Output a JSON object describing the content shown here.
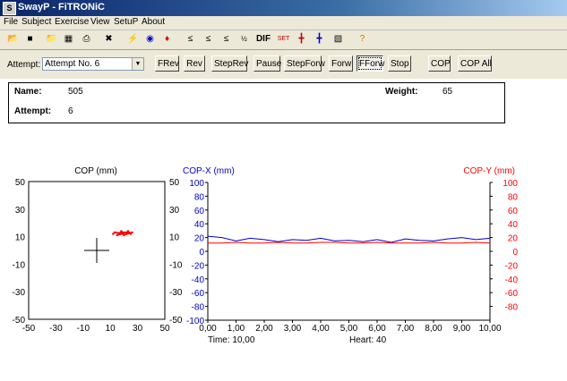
{
  "window": {
    "title": "SwayP - FiTRONiC",
    "icon": "app-icon"
  },
  "menu": [
    "File",
    "Subject",
    "Exercise",
    "View",
    "SetuP",
    "About"
  ],
  "toolbar": {
    "icons": [
      "open-folder-icon",
      "save-disk-icon",
      "open-file-icon",
      "report-icon",
      "print-icon",
      "tools-icon",
      "yellow-lightning-icon",
      "eye-icon",
      "red-flame-icon",
      "filter-1-icon",
      "filter-2-icon",
      "filter-h-icon",
      "sort-icon",
      "dif-icon",
      "settings-icon",
      "cop-cross-icon",
      "cop-multi-icon",
      "printer-icon",
      "help-icon"
    ],
    "dif_label": "DIF"
  },
  "controls": {
    "attempt_label": "Attempt:",
    "attempt_value": "Attempt No. 6",
    "buttons": [
      "FRev",
      "Rev",
      "StepRev",
      "Pause",
      "StepForw",
      "Forw",
      "FForw",
      "Stop",
      "COP",
      "COP All"
    ],
    "pressed": "FForw"
  },
  "info": {
    "name_label": "Name:",
    "name_value": "505",
    "weight_label": "Weight:",
    "weight_value": "65",
    "attempt_label": "Attempt:",
    "attempt_value": "6"
  },
  "status": {
    "time": "Time: 10,00",
    "heart": "Heart: 40"
  },
  "colors": {
    "copx": "#0000cc",
    "copy": "#ff0000",
    "cop": "#ff0000",
    "chrome": "#ece9d8"
  },
  "chart_data": [
    {
      "type": "scatter",
      "title": "COP (mm)",
      "xlim": [
        -50,
        50
      ],
      "ylim": [
        -50,
        50
      ],
      "x_ticks": [
        "-50",
        "-30",
        "-10",
        "10",
        "30",
        "50"
      ],
      "y_ticks_left": [
        "50",
        "30",
        "10",
        "-10",
        "-30",
        "-50"
      ],
      "y_ticks_right": [
        "50",
        "30",
        "10",
        "-10",
        "-30",
        "-50"
      ],
      "crosshair": [
        0,
        0
      ],
      "points": [
        [
          12,
          12
        ],
        [
          14,
          13
        ],
        [
          16,
          12
        ],
        [
          18,
          14
        ],
        [
          20,
          13
        ],
        [
          22,
          12
        ],
        [
          24,
          13
        ],
        [
          15,
          11
        ],
        [
          17,
          12
        ],
        [
          19,
          12
        ],
        [
          21,
          13
        ],
        [
          23,
          14
        ],
        [
          25,
          12
        ],
        [
          13,
          13
        ],
        [
          26,
          13
        ],
        [
          20,
          11
        ]
      ]
    },
    {
      "type": "line",
      "title_left": "COP-X (mm)",
      "title_right": "COP-Y (mm)",
      "x_ticks": [
        "0,00",
        "1,00",
        "2,00",
        "3,00",
        "4,00",
        "5,00",
        "6,00",
        "7,00",
        "8,00",
        "9,00",
        "10,00"
      ],
      "xlim": [
        0,
        10
      ],
      "y_left_ticks": [
        "100",
        "80",
        "60",
        "40",
        "20",
        "0",
        "-20",
        "-40",
        "-60",
        "-80",
        "-100"
      ],
      "y_right_ticks": [
        "100",
        "80",
        "60",
        "40",
        "20",
        "0",
        "-20",
        "-40",
        "-60",
        "-80"
      ],
      "ylim": [
        -100,
        100
      ],
      "series": [
        {
          "values_x": [
            0,
            0.5,
            1,
            1.5,
            2,
            2.5,
            3,
            3.5,
            4,
            4.5,
            5,
            5.5,
            6,
            6.5,
            7,
            7.5,
            8,
            8.5,
            9,
            9.5,
            10
          ],
          "values_y": [
            22,
            20,
            15,
            19,
            17,
            14,
            17,
            16,
            19,
            15,
            16,
            14,
            17,
            13,
            18,
            16,
            15,
            18,
            20,
            17,
            19
          ]
        },
        {
          "values_x": [
            0,
            0.5,
            1,
            1.5,
            2,
            2.5,
            3,
            3.5,
            4,
            4.5,
            5,
            5.5,
            6,
            6.5,
            7,
            7.5,
            8,
            8.5,
            9,
            9.5,
            10
          ],
          "values_y": [
            12,
            12,
            13,
            12,
            12,
            13,
            12,
            12,
            13,
            13,
            12,
            12,
            13,
            12,
            12,
            12,
            13,
            12,
            12,
            13,
            12
          ]
        }
      ]
    }
  ]
}
